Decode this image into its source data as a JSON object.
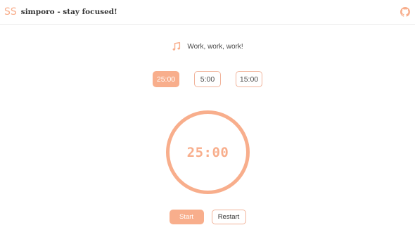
{
  "header": {
    "logo_text": "SS",
    "title": "simporo - stay focused!",
    "github_icon": "github-icon"
  },
  "status": {
    "icon": "music-notes-icon",
    "message": "Work, work, work!"
  },
  "presets": [
    {
      "label": "25:00",
      "active": true
    },
    {
      "label": "5:00",
      "active": false
    },
    {
      "label": "15:00",
      "active": false
    }
  ],
  "timer": {
    "display": "25:00"
  },
  "controls": {
    "start_label": "Start",
    "restart_label": "Restart"
  },
  "colors": {
    "accent": "#F8AE8C",
    "border": "#F1B39A"
  }
}
